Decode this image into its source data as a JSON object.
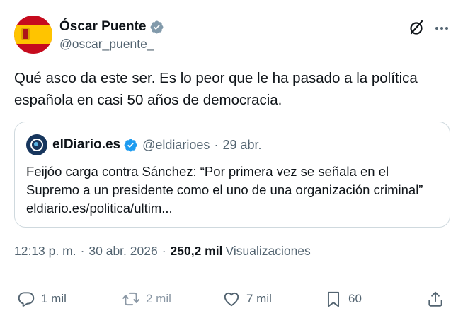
{
  "author": {
    "name": "Óscar Puente",
    "handle": "@oscar_puente_"
  },
  "tweet": {
    "text": "Qué asco da este ser. Es lo peor que le ha pasado a la política española en casi 50 años de democracia."
  },
  "quoted": {
    "name": "elDiario.es",
    "handle": "@eldiarioes",
    "separator": "·",
    "date": "29 abr.",
    "text": "Feijóo carga contra Sánchez: “Por primera vez se señala en el Supremo a un presidente como el uno de una organización criminal” eldiario.es/politica/ultim..."
  },
  "meta": {
    "time": "12:13 p. m.",
    "sep1": "·",
    "date": "30 abr. 2026",
    "sep2": "·",
    "views_count": "250,2 mil",
    "views_label": "Visualizaciones"
  },
  "actions": {
    "replies": "1 mil",
    "reposts": "2 mil",
    "likes": "7 mil",
    "bookmarks": "60"
  },
  "icons": {
    "author_verified": "verified-grey-badge-icon",
    "quoted_verified": "verified-blue-badge-icon",
    "grok": "grok-icon",
    "more": "more-dots-icon",
    "reply": "reply-icon",
    "repost": "repost-icon",
    "like": "heart-icon",
    "bookmark": "bookmark-icon",
    "share": "share-icon"
  },
  "colors": {
    "text": "#0f1419",
    "secondary": "#536471",
    "border": "#cfd9de",
    "verified_blue": "#1d9bf0",
    "verified_grey": "#829aab"
  }
}
